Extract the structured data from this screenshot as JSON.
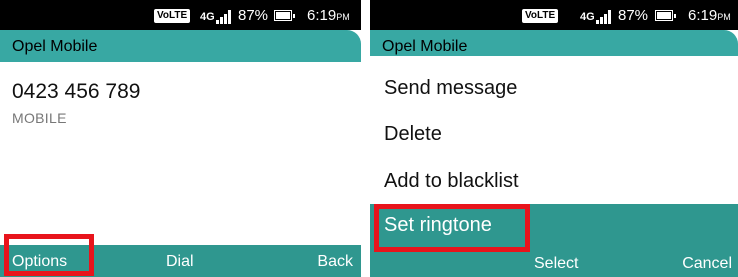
{
  "status_bar": {
    "volte_label": "VoLTE",
    "network_label": "4G",
    "battery_percent": "87%",
    "time": "6:19",
    "time_suffix": "PM"
  },
  "contact_screen": {
    "title": "Opel Mobile",
    "number": "0423 456 789",
    "number_type": "MOBILE",
    "softkeys": {
      "left": "Options",
      "center": "Dial",
      "right": "Back"
    }
  },
  "options_menu": {
    "background_title": "Opel Mobile",
    "items": [
      {
        "label": "Send message"
      },
      {
        "label": "Delete"
      },
      {
        "label": "Add to blacklist"
      },
      {
        "label": "Set ringtone",
        "selected": true
      }
    ],
    "softkeys": {
      "center": "Select",
      "right": "Cancel"
    }
  },
  "colors": {
    "accent_teal": "#38a8a3",
    "softkey_teal": "#2f978f",
    "highlight_red": "#e8141c",
    "status_bar": "#000000"
  }
}
